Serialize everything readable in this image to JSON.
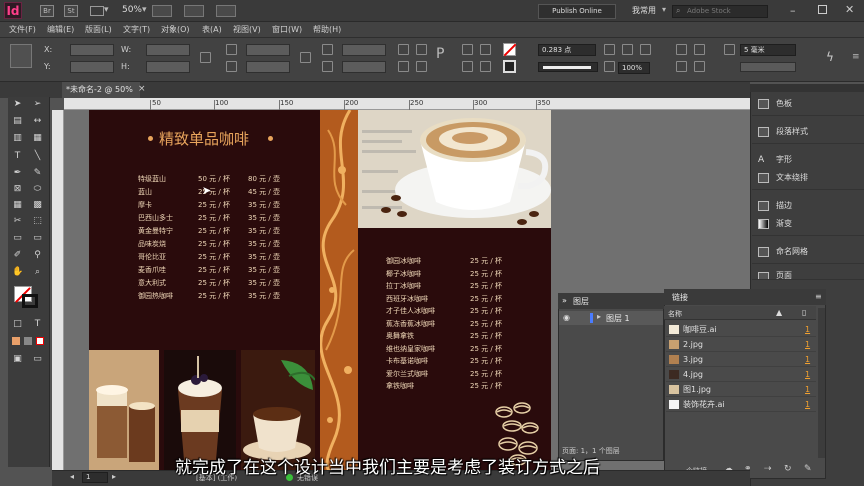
{
  "app": {
    "logo": "Id",
    "bridge": "Br",
    "stock": "St",
    "zoom": "50%",
    "publish": "Publish Online",
    "workspace": "我常用",
    "search_placeholder": "Adobe Stock"
  },
  "menu": [
    "文件(F)",
    "编辑(E)",
    "版面(L)",
    "文字(T)",
    "对象(O)",
    "表(A)",
    "视图(V)",
    "窗口(W)",
    "帮助(H)"
  ],
  "control": {
    "x_label": "X:",
    "y_label": "Y:",
    "w_label": "W:",
    "h_label": "H:",
    "stroke_weight": "0.283 点",
    "opacity": "100%",
    "gutter": "5 毫米"
  },
  "tab": {
    "name": "*未命名-2 @ 50%",
    "close": "×"
  },
  "ruler": {
    "ticks": [
      "50",
      "100",
      "150",
      "200",
      "250",
      "300",
      "350"
    ]
  },
  "page": {
    "title": "精致单品咖啡",
    "menu_left": [
      {
        "name": "特级蓝山",
        "small": "50 元 / 杯",
        "large": "80 元 / 壶"
      },
      {
        "name": "蓝山",
        "small": "25 元 / 杯",
        "large": "45 元 / 壶"
      },
      {
        "name": "摩卡",
        "small": "25 元 / 杯",
        "large": "35 元 / 壶"
      },
      {
        "name": "巴西山多士",
        "small": "25 元 / 杯",
        "large": "35 元 / 壶"
      },
      {
        "name": "黄金曼特宁",
        "small": "25 元 / 杯",
        "large": "35 元 / 壶"
      },
      {
        "name": "品味炭烧",
        "small": "25 元 / 杯",
        "large": "35 元 / 壶"
      },
      {
        "name": "哥伦比亚",
        "small": "25 元 / 杯",
        "large": "35 元 / 壶"
      },
      {
        "name": "麦香爪哇",
        "small": "25 元 / 杯",
        "large": "35 元 / 壶"
      },
      {
        "name": "意大利式",
        "small": "25 元 / 杯",
        "large": "35 元 / 壶"
      },
      {
        "name": "御园热咖啡",
        "small": "25 元 / 杯",
        "large": "35 元 / 壶"
      }
    ],
    "menu_right": [
      {
        "name": "御园冰咖啡",
        "price": "25 元 / 杯"
      },
      {
        "name": "椰子冰咖啡",
        "price": "25 元 / 杯"
      },
      {
        "name": "拉丁冰咖啡",
        "price": "25 元 / 杯"
      },
      {
        "name": "西班牙冰咖啡",
        "price": "25 元 / 杯"
      },
      {
        "name": "才子佳人冰咖啡",
        "price": "25 元 / 杯"
      },
      {
        "name": "蕉冻香蕉冰咖啡",
        "price": "25 元 / 杯"
      },
      {
        "name": "奥舞拿铁",
        "price": "25 元 / 杯"
      },
      {
        "name": "维也纳皇家咖啡",
        "price": "25 元 / 杯"
      },
      {
        "name": "卡布基诺咖啡",
        "price": "25 元 / 杯"
      },
      {
        "name": "爱尔兰式咖啡",
        "price": "25 元 / 杯"
      },
      {
        "name": "拿铁咖啡",
        "price": "25 元 / 杯"
      }
    ]
  },
  "panels": {
    "items": [
      "色板",
      "段落样式",
      "字形",
      "文本绕排",
      "描边",
      "渐变",
      "命名网格",
      "页面"
    ]
  },
  "layers_panel": {
    "tab": "图层",
    "layer": "图层 1",
    "footer": "页面: 1，1 个图层"
  },
  "links_panel": {
    "tab": "链接",
    "header_name": "名称",
    "files": [
      {
        "name": "咖啡豆.ai",
        "count": "1"
      },
      {
        "name": "2.jpg",
        "count": "1"
      },
      {
        "name": "3.jpg",
        "count": "1"
      },
      {
        "name": "4.jpg",
        "count": "1"
      },
      {
        "name": "图1.jpg",
        "count": "1"
      },
      {
        "name": "装饰花卉.ai",
        "count": "1"
      }
    ],
    "footer": "个链接"
  },
  "status": {
    "page": "1",
    "style": "[基本] (工作)",
    "error": "无错误"
  },
  "subtitle": "就完成了在这个设计当中我们主要是考虑了装订方式之后",
  "colors": {
    "page_bg": "#2a0b0c",
    "accent": "#e8a45c",
    "strip": "#b35b1e",
    "link_num": "#f0a030"
  }
}
